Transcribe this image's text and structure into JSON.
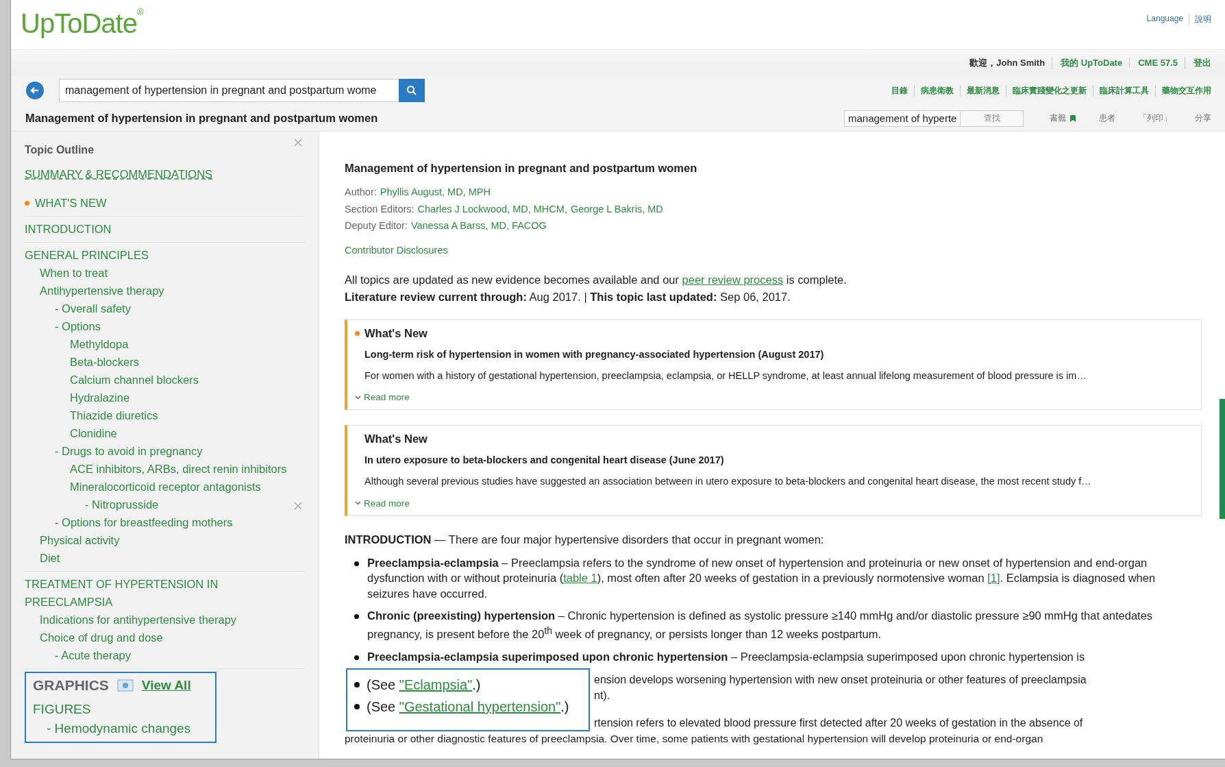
{
  "header": {
    "logo": "UpToDate$^{®}$",
    "top_links": [
      "Language",
      "說明"
    ],
    "user_links": [
      {
        "label": "歡迎，John Smith",
        "kind": "text"
      },
      {
        "label": "我的 UpToDate",
        "kind": "link"
      },
      {
        "label": "CME 57.5",
        "kind": "link"
      },
      {
        "label": "登出",
        "kind": "link"
      }
    ],
    "search": {
      "value": "management of hypertension in pregnant and postpartum wome"
    },
    "nav": [
      "目錄",
      "病患衛教",
      "最新消息",
      "臨床實踐變化之更新",
      "臨床計算工具",
      "藥物交互作用"
    ]
  },
  "topic_bar": {
    "title": "Management of hypertension in pregnant and postpartum women",
    "find": {
      "value": "management of hyperte",
      "button": "查找"
    },
    "tools": [
      {
        "label": "書籤",
        "kind": "bookmark"
      },
      {
        "label": "患者",
        "kind": "plain"
      },
      {
        "label": "「列印」",
        "kind": "plain"
      },
      {
        "label": "分享",
        "kind": "plain"
      }
    ]
  },
  "sidebar": {
    "title": "Topic Outline",
    "sections": [
      {
        "items": [
          {
            "label": "SUMMARY & RECOMMENDATIONS",
            "kind": "summary"
          },
          {
            "label": "WHAT'S NEW",
            "kind": "new"
          }
        ]
      },
      {
        "items": [
          {
            "label": "INTRODUCTION",
            "kind": "heading"
          }
        ]
      },
      {
        "items": [
          {
            "label": "GENERAL PRINCIPLES",
            "kind": "heading",
            "children": [
              {
                "label": "When to treat"
              },
              {
                "label": "Antihypertensive therapy",
                "children": [
                  {
                    "label": "- Overall safety"
                  },
                  {
                    "label": "- Options",
                    "children": [
                      {
                        "label": "Methyldopa"
                      },
                      {
                        "label": "Beta-blockers"
                      },
                      {
                        "label": "Calcium channel blockers"
                      },
                      {
                        "label": "Hydralazine"
                      },
                      {
                        "label": "Thiazide diuretics"
                      },
                      {
                        "label": "Clonidine"
                      }
                    ]
                  },
                  {
                    "label": "- Drugs to avoid in pregnancy",
                    "children": [
                      {
                        "label": "ACE inhibitors, ARBs, direct renin inhibitors"
                      },
                      {
                        "label": "Mineralocorticoid receptor antagonists",
                        "children": [
                          {
                            "label": "- Nitroprusside"
                          }
                        ]
                      }
                    ]
                  },
                  {
                    "label": "- Options for breastfeeding mothers"
                  }
                ]
              },
              {
                "label": "Physical activity"
              },
              {
                "label": "Diet"
              }
            ]
          }
        ]
      },
      {
        "items": [
          {
            "label": "TREATMENT OF HYPERTENSION IN PREECLAMPSIA",
            "kind": "heading",
            "children": [
              {
                "label": "Indications for antihypertensive therapy"
              },
              {
                "label": "Choice of drug and dose",
                "children": [
                  {
                    "label": "- Acute therapy"
                  }
                ]
              }
            ]
          }
        ]
      }
    ],
    "graphics": {
      "title": "GRAPHICS",
      "view_all": "View All",
      "heading": "FIGURES",
      "figures": [
        "- Hemodynamic changes"
      ]
    }
  },
  "article": {
    "title": "Management of hypertension in pregnant and postpartum women",
    "credits": [
      {
        "label": "Author:",
        "names": [
          "Phyllis August, MD, MPH"
        ]
      },
      {
        "label": "Section Editors:",
        "names": [
          "Charles J Lockwood, MD, MHCM,",
          "George L Bakris, MD"
        ]
      },
      {
        "label": "Deputy Editor:",
        "names": [
          "Vanessa A Barss, MD, FACOG"
        ]
      }
    ],
    "disclosures": "Contributor Disclosures",
    "update_note": {
      "before": "All topics are updated as new evidence becomes available and our ",
      "link": "peer review process",
      "after": " is complete."
    },
    "review_line": "**Literature review current through:** Aug 2017. | **This topic last updated:** Sep 06, 2017.",
    "whats_new": [
      {
        "heading": "What's New",
        "dot": true,
        "title": "Long-term risk of hypertension in women with pregnancy-associated hypertension (August 2017)",
        "summary": "For women with a history of gestational hypertension, preeclampsia, eclampsia, or HELLP syndrome, at least annual lifelong measurement of blood pressure is im…",
        "read_more": "Read more"
      },
      {
        "heading": "What's New",
        "dot": false,
        "title": "In utero exposure to beta-blockers and congenital heart disease (June 2017)",
        "summary": "Although several previous studies have suggested an association between in utero exposure to beta-blockers and congenital heart disease, the most recent study f…",
        "read_more": "Read more"
      }
    ],
    "intro": "**INTRODUCTION** — There are four major hypertensive disorders that occur in pregnant women:",
    "bullets": [
      {
        "parts": [
          {
            "text": "**Preeclampsia-eclampsia** – Preeclampsia refers to the syndrome of new onset of hypertension and proteinuria or new onset of hypertension and end-organ dysfunction with or without proteinuria ("
          },
          {
            "link": "table 1"
          },
          {
            "text": "), most often after 20 weeks of gestation in a previously normotensive woman "
          },
          {
            "link": "[1]"
          },
          {
            "text": ". Eclampsia is diagnosed when seizures have occurred."
          }
        ]
      },
      {
        "parts": [
          {
            "text": "**Chronic (preexisting) hypertension** – Chronic hypertension is defined as systolic pressure ≥140 mmHg and/or diastolic pressure ≥90 mmHg that antedates pregnancy, is present before the 20$^{th}$ week of pregnancy, or persists longer than 12 weeks postpartum."
          }
        ]
      },
      {
        "parts": [
          {
            "text": "**Preeclampsia-eclampsia superimposed upon chronic hypertension** – Preeclampsia-eclampsia superimposed upon chronic hypertension is"
          }
        ]
      }
    ],
    "see_inset": [
      {
        "before": "(See ",
        "link": "\"Eclampsia\"",
        "after": ".)"
      },
      {
        "before": "(See ",
        "link": "\"Gestational hypertension\"",
        "after": ".)"
      }
    ],
    "covered_lines": [
      "ension develops worsening hypertension with new onset proteinuria or other features of preeclampsia",
      "nt).",
      "rtension refers to elevated blood pressure first detected after 20 weeks of gestation in the absence of"
    ],
    "last_line": "proteinuria or other diagnostic features of preeclampsia. Over time, some patients with gestational hypertension will develop proteinuria or end-organ"
  }
}
